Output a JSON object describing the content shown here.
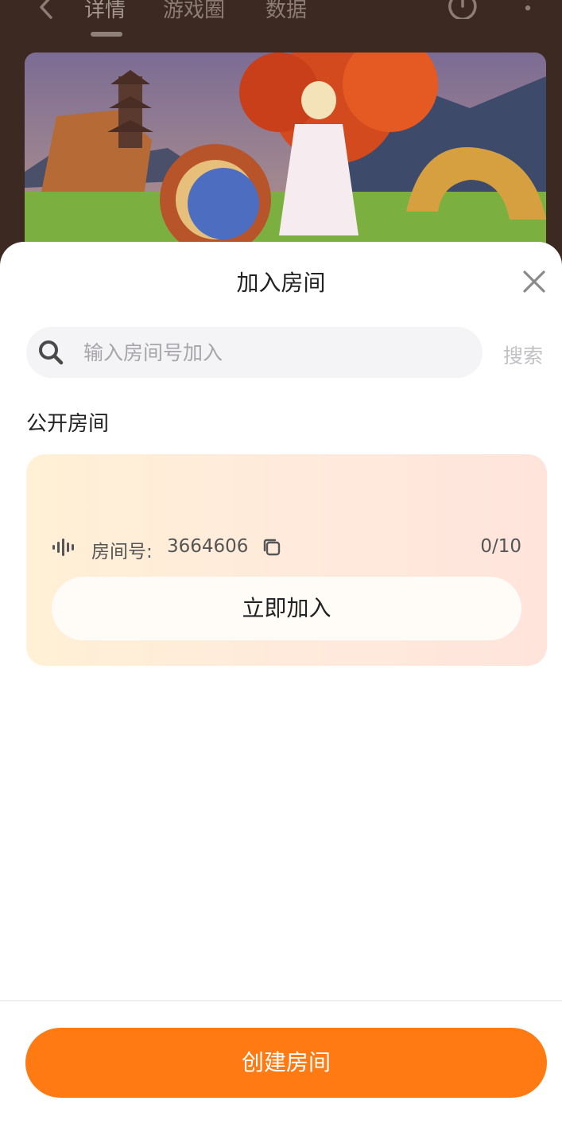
{
  "background": {
    "tabs": [
      {
        "label": "详情",
        "active": true
      },
      {
        "label": "游戏圈",
        "active": false
      },
      {
        "label": "数据",
        "active": false
      }
    ]
  },
  "sheet": {
    "title": "加入房间",
    "search": {
      "placeholder": "输入房间号加入",
      "value": "",
      "button_label": "搜索"
    },
    "section_title": "公开房间",
    "room": {
      "label": "房间号:",
      "number": "3664606",
      "count": "0/10",
      "join_label": "立即加入"
    },
    "create_label": "创建房间"
  },
  "colors": {
    "accent": "#ff7a12",
    "card_gradient_start": "#fff0d6",
    "card_gradient_end": "#ffe4dc"
  },
  "icons": [
    "back-arrow-icon",
    "history-icon",
    "more-icon",
    "close-icon",
    "search-icon",
    "voice-wave-icon",
    "copy-icon"
  ]
}
